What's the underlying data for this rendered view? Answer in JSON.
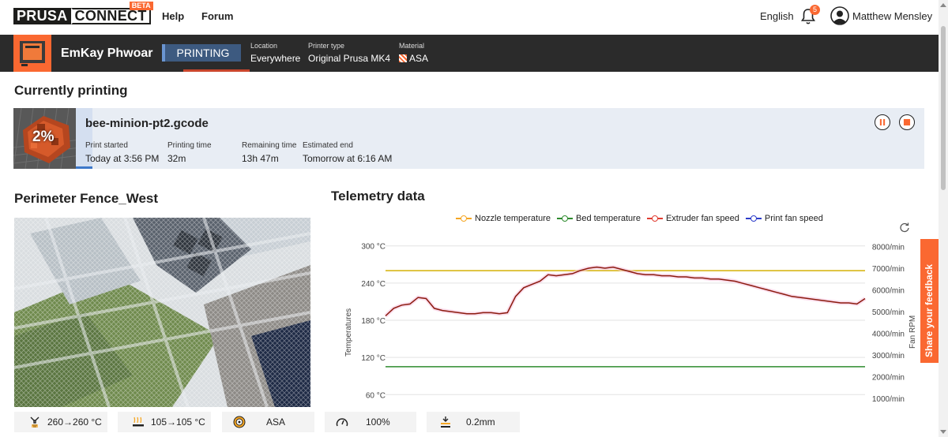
{
  "nav": {
    "logo_left": "PRUSA",
    "logo_right": "CONNECT",
    "logo_badge": "BETA",
    "help": "Help",
    "forum": "Forum",
    "language": "English",
    "notification_count": "5",
    "username": "Matthew Mensley"
  },
  "printer": {
    "name": "EmKay Phwoar",
    "state": "PRINTING",
    "location_label": "Location",
    "location_value": "Everywhere",
    "type_label": "Printer type",
    "type_value": "Original Prusa MK4",
    "material_label": "Material",
    "material_value": "ASA"
  },
  "current": {
    "title": "Currently printing",
    "progress_text": "2%",
    "progress": 0.02,
    "file": "bee-minion-pt2.gcode",
    "start_label": "Print started",
    "start_value": "Today at 3:56 PM",
    "ptime_label": "Printing time",
    "ptime_value": "32m",
    "remaining_label": "Remaining time",
    "remaining_value": "13h 47m",
    "end_label": "Estimated end",
    "end_value": "Tomorrow at 6:16 AM"
  },
  "camera": {
    "title": "Perimeter Fence_West"
  },
  "telemetry": {
    "title": "Telemetry data",
    "legend": [
      {
        "name": "Nozzle temperature",
        "color": "#f5a623"
      },
      {
        "name": "Bed temperature",
        "color": "#2e8b2e"
      },
      {
        "name": "Extruder fan speed",
        "color": "#e03c31"
      },
      {
        "name": "Print fan speed",
        "color": "#2c3cc9"
      }
    ],
    "feedback": "Share your feedback"
  },
  "chart_data": {
    "type": "line",
    "ylabel": "Temperatures",
    "y2label": "Fan RPM",
    "y_ticks": [
      "300 °C",
      "240 °C",
      "180 °C",
      "120 °C",
      "60 °C"
    ],
    "y_tick_values": [
      300,
      240,
      180,
      120,
      60
    ],
    "y2_ticks": [
      "8000/min",
      "7000/min",
      "6000/min",
      "5000/min",
      "4000/min",
      "3000/min",
      "2000/min",
      "1000/min"
    ],
    "y2_tick_values": [
      8000,
      7000,
      6000,
      5000,
      4000,
      3000,
      2000,
      1000
    ],
    "ylim": [
      40,
      320
    ],
    "y2lim": [
      600,
      8600
    ],
    "grid": true,
    "series": [
      {
        "name": "Nozzle temperature",
        "color": "#d4b106",
        "axis": "temp",
        "values": [
          260,
          260,
          260,
          260,
          260,
          260,
          260,
          260,
          260,
          260,
          260,
          260,
          260,
          260,
          260,
          260,
          260,
          260,
          260,
          260,
          260,
          260,
          260,
          260,
          260,
          260,
          260,
          260,
          260,
          260,
          260,
          260,
          260,
          260,
          260,
          260,
          260,
          260,
          260,
          260,
          260,
          260,
          260,
          260,
          260,
          260,
          260,
          260,
          260,
          260,
          260,
          260,
          260,
          260,
          260,
          260,
          260,
          260,
          260,
          260
        ]
      },
      {
        "name": "Bed temperature",
        "color": "#2e8b2e",
        "axis": "temp",
        "values": [
          105,
          105,
          105,
          105,
          105,
          105,
          105,
          105,
          105,
          105,
          105,
          105,
          105,
          105,
          105,
          105,
          105,
          105,
          105,
          105,
          105,
          105,
          105,
          105,
          105,
          105,
          105,
          105,
          105,
          105,
          105,
          105,
          105,
          105,
          105,
          105,
          105,
          105,
          105,
          105,
          105,
          105,
          105,
          105,
          105,
          105,
          105,
          105,
          105,
          105,
          105,
          105,
          105,
          105,
          105,
          105,
          105,
          105,
          105,
          105
        ]
      },
      {
        "name": "Extruder fan speed",
        "color": "#8b1a0e",
        "axis": "fan",
        "values": [
          4800,
          5150,
          5300,
          5350,
          5650,
          5600,
          5150,
          5050,
          5000,
          4950,
          4900,
          4900,
          4950,
          4950,
          4900,
          4950,
          5700,
          6100,
          6250,
          6400,
          6700,
          6650,
          6700,
          6750,
          6900,
          7000,
          7050,
          7000,
          7050,
          6950,
          6850,
          6750,
          6700,
          6700,
          6650,
          6650,
          6600,
          6600,
          6550,
          6550,
          6500,
          6500,
          6450,
          6400,
          6300,
          6200,
          6100,
          6000,
          5900,
          5800,
          5700,
          5650,
          5600,
          5550,
          5500,
          5450,
          5400,
          5400,
          5350,
          5600
        ]
      }
    ]
  },
  "stats": {
    "nozzle": "260→260 °C",
    "bed": "105→105 °C",
    "material": "ASA",
    "speed": "100%",
    "layer": "0.2mm"
  }
}
